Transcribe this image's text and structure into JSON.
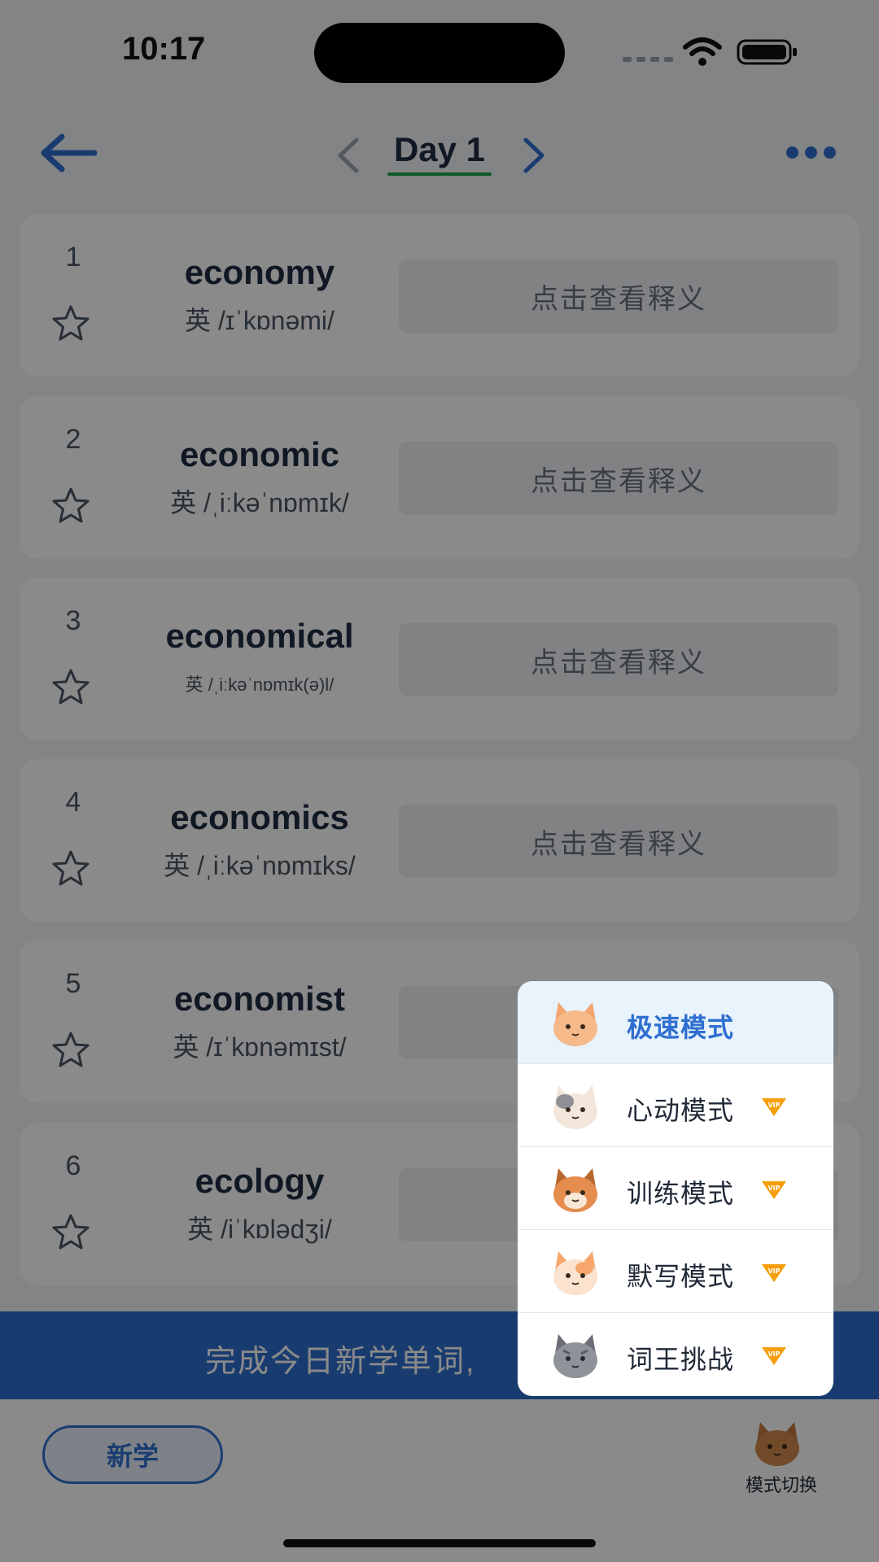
{
  "status_bar": {
    "time": "10:17"
  },
  "header": {
    "title": "Day 1",
    "back_icon": "arrow-left-icon",
    "prev_icon": "chevron-left-icon",
    "next_icon": "chevron-right-icon",
    "more_icon": "more-horizontal-icon"
  },
  "words": [
    {
      "index": "1",
      "word": "economy",
      "phonetic": "英 /ɪˈkɒnəmi/",
      "meaning_label": "点击查看释义"
    },
    {
      "index": "2",
      "word": "economic",
      "phonetic": "英 /ˌiːkəˈnɒmɪk/",
      "meaning_label": "点击查看释义"
    },
    {
      "index": "3",
      "word": "economical",
      "phonetic": "英 /ˌiːkəˈnɒmɪk(ə)l/",
      "meaning_label": "点击查看释义"
    },
    {
      "index": "4",
      "word": "economics",
      "phonetic": "英 /ˌiːkəˈnɒmɪks/",
      "meaning_label": "点击查看释义"
    },
    {
      "index": "5",
      "word": "economist",
      "phonetic": "英 /ɪˈkɒnəmɪst/",
      "meaning_label": "点击查看释义"
    },
    {
      "index": "6",
      "word": "ecology",
      "phonetic": "英 /iˈkɒlədʒi/",
      "meaning_label": "点击查看释义"
    }
  ],
  "banner": {
    "text": "完成今日新学单词,"
  },
  "bottom_bar": {
    "new_learn_label": "新学",
    "mode_switch_label": "模式切换"
  },
  "mode_menu": {
    "items": [
      {
        "label": "极速模式",
        "active": true,
        "vip": false,
        "cat_color": "#f6b98a"
      },
      {
        "label": "心动模式",
        "active": false,
        "vip": true,
        "cat_color": "#f3e7dc"
      },
      {
        "label": "训练模式",
        "active": false,
        "vip": true,
        "cat_color": "#e58d4f"
      },
      {
        "label": "默写模式",
        "active": false,
        "vip": true,
        "cat_color": "#f7a76b"
      },
      {
        "label": "词王挑战",
        "active": false,
        "vip": true,
        "cat_color": "#8f9399"
      }
    ]
  },
  "colors": {
    "accent": "#2f6fd0",
    "underline": "#16a34a",
    "vip": "#f59e0b"
  }
}
